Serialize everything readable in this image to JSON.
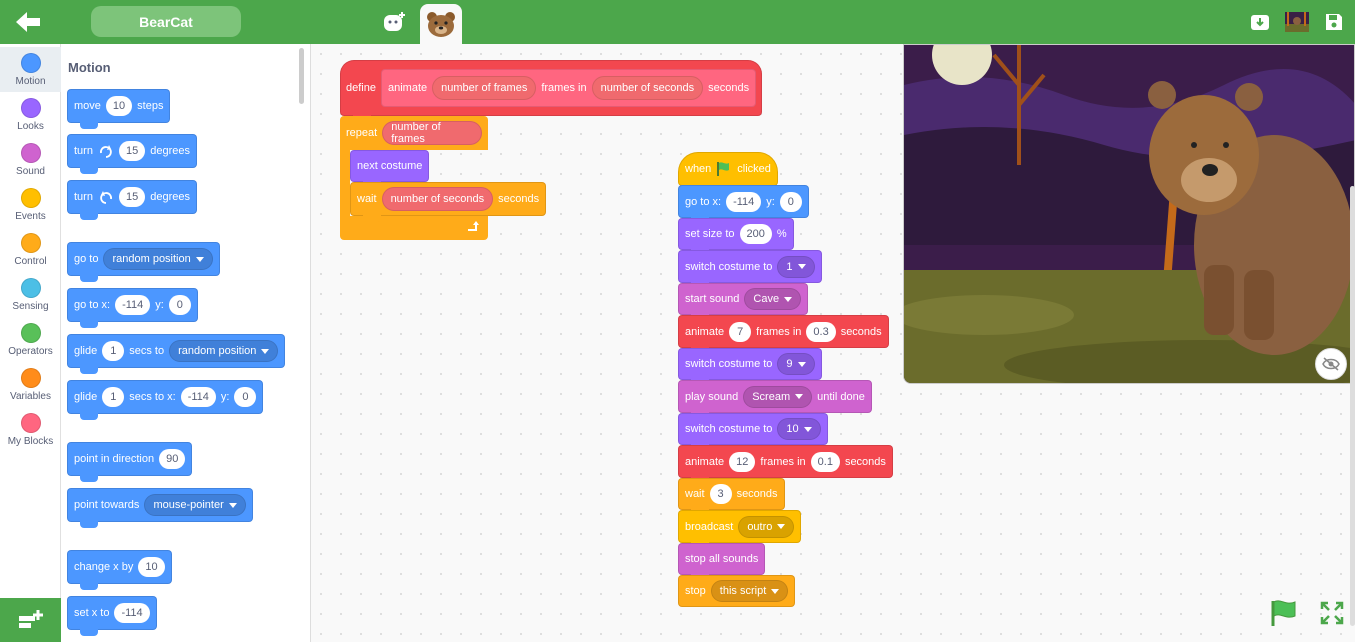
{
  "app": {
    "project_name": "BearCat"
  },
  "categories": [
    {
      "label": "Motion",
      "color": "#4c97ff"
    },
    {
      "label": "Looks",
      "color": "#9966ff"
    },
    {
      "label": "Sound",
      "color": "#cf63cf"
    },
    {
      "label": "Events",
      "color": "#ffbf00"
    },
    {
      "label": "Control",
      "color": "#ffab19"
    },
    {
      "label": "Sensing",
      "color": "#4cbfe6"
    },
    {
      "label": "Operators",
      "color": "#59c059"
    },
    {
      "label": "Variables",
      "color": "#ff8c1a"
    },
    {
      "label": "My Blocks",
      "color": "#ff6680"
    }
  ],
  "palette": {
    "title": "Motion",
    "move": {
      "label": "move",
      "value": "10",
      "suffix": "steps"
    },
    "turn_right": {
      "label": "turn",
      "value": "15",
      "suffix": "degrees"
    },
    "turn_left": {
      "label": "turn",
      "value": "15",
      "suffix": "degrees"
    },
    "goto": {
      "label": "go to",
      "option": "random position"
    },
    "goto_xy": {
      "label": "go to x:",
      "x": "-114",
      "ylabel": "y:",
      "y": "0"
    },
    "glide": {
      "label": "glide",
      "value": "1",
      "mid": "secs to",
      "option": "random position"
    },
    "glide_xy": {
      "label": "glide",
      "value": "1",
      "mid": "secs to x:",
      "x": "-114",
      "ylabel": "y:",
      "y": "0"
    },
    "point_dir": {
      "label": "point in direction",
      "value": "90"
    },
    "point_towards": {
      "label": "point towards",
      "option": "mouse-pointer"
    },
    "change_x": {
      "label": "change x by",
      "value": "10"
    },
    "set_x": {
      "label": "set x to",
      "value": "-114"
    }
  },
  "define_script": {
    "define": "define",
    "name": "animate",
    "arg1": "number of frames",
    "mid": "frames in",
    "arg2": "number of seconds",
    "end": "seconds",
    "repeat": "repeat",
    "repeat_arg": "number of frames",
    "next_costume": "next costume",
    "wait": "wait",
    "wait_arg": "number of seconds",
    "wait_end": "seconds"
  },
  "main_script": {
    "hat_when": "when",
    "hat_clicked": "clicked",
    "goto": {
      "label": "go to x:",
      "x": "-114",
      "ylabel": "y:",
      "y": "0"
    },
    "setsize": {
      "label": "set size to",
      "value": "200",
      "suffix": "%"
    },
    "switch1": {
      "label": "switch costume to",
      "value": "1"
    },
    "startsound": {
      "label": "start sound",
      "value": "Cave"
    },
    "animate1": {
      "label": "animate",
      "frames": "7",
      "mid": "frames in",
      "secs": "0.3",
      "end": "seconds"
    },
    "switch2": {
      "label": "switch costume to",
      "value": "9"
    },
    "playsound": {
      "label": "play sound",
      "value": "Scream",
      "end": "until done"
    },
    "switch3": {
      "label": "switch costume to",
      "value": "10"
    },
    "animate2": {
      "label": "animate",
      "frames": "12",
      "mid": "frames in",
      "secs": "0.1",
      "end": "seconds"
    },
    "wait": {
      "label": "wait",
      "value": "3",
      "end": "seconds"
    },
    "broadcast": {
      "label": "broadcast",
      "value": "outro"
    },
    "stopsounds": {
      "label": "stop all sounds"
    },
    "stop": {
      "label": "stop",
      "value": "this script"
    }
  }
}
